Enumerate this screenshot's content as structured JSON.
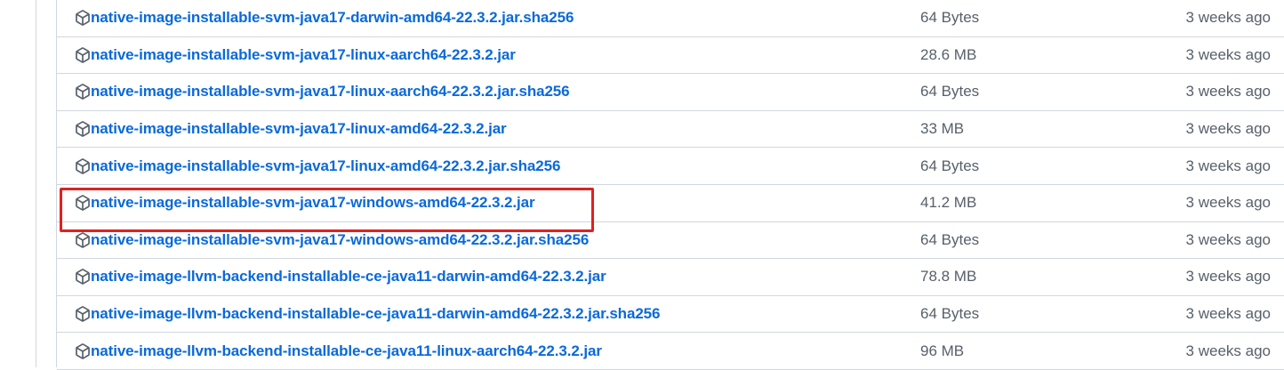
{
  "assets": [
    {
      "name": "native-image-installable-svm-java17-darwin-amd64-22.3.2.jar.sha256",
      "size": "64 Bytes",
      "age": "3 weeks ago"
    },
    {
      "name": "native-image-installable-svm-java17-linux-aarch64-22.3.2.jar",
      "size": "28.6 MB",
      "age": "3 weeks ago"
    },
    {
      "name": "native-image-installable-svm-java17-linux-aarch64-22.3.2.jar.sha256",
      "size": "64 Bytes",
      "age": "3 weeks ago"
    },
    {
      "name": "native-image-installable-svm-java17-linux-amd64-22.3.2.jar",
      "size": "33 MB",
      "age": "3 weeks ago"
    },
    {
      "name": "native-image-installable-svm-java17-linux-amd64-22.3.2.jar.sha256",
      "size": "64 Bytes",
      "age": "3 weeks ago"
    },
    {
      "name": "native-image-installable-svm-java17-windows-amd64-22.3.2.jar",
      "size": "41.2 MB",
      "age": "3 weeks ago"
    },
    {
      "name": "native-image-installable-svm-java17-windows-amd64-22.3.2.jar.sha256",
      "size": "64 Bytes",
      "age": "3 weeks ago"
    },
    {
      "name": "native-image-llvm-backend-installable-ce-java11-darwin-amd64-22.3.2.jar",
      "size": "78.8 MB",
      "age": "3 weeks ago"
    },
    {
      "name": "native-image-llvm-backend-installable-ce-java11-darwin-amd64-22.3.2.jar.sha256",
      "size": "64 Bytes",
      "age": "3 weeks ago"
    },
    {
      "name": "native-image-llvm-backend-installable-ce-java11-linux-aarch64-22.3.2.jar",
      "size": "96 MB",
      "age": "3 weeks ago"
    }
  ],
  "icon": "package-icon",
  "colors": {
    "link": "#0969da",
    "muted": "#57606a",
    "border": "#d0d7de",
    "highlight": "#e02020"
  }
}
